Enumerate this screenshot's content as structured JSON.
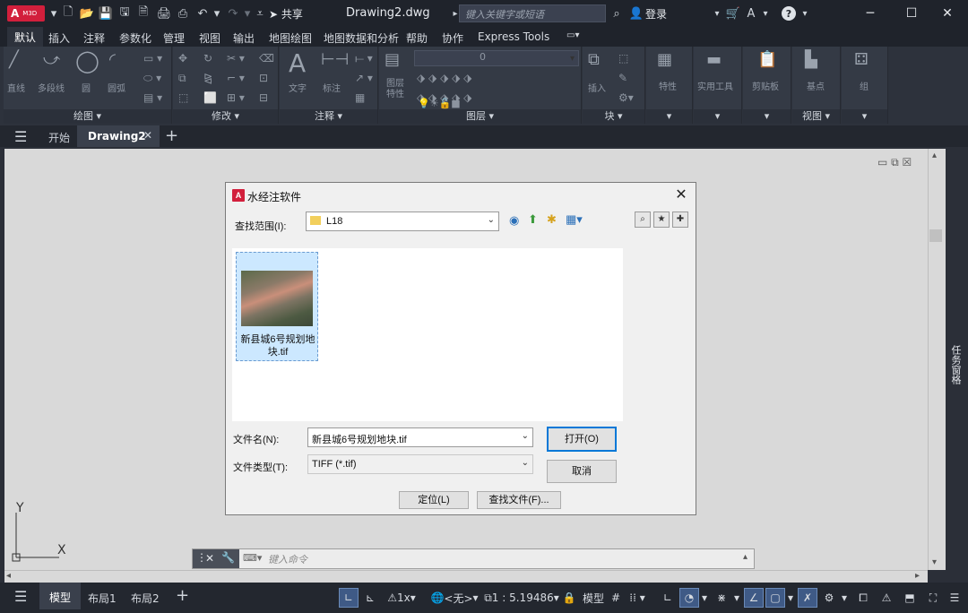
{
  "app": {
    "logo_text": "A",
    "logo_sub": "M3D",
    "doc_title": "Drawing2.dwg",
    "search_placeholder": "键入关键字或短语",
    "share_label": "共享",
    "login_label": "登录"
  },
  "ribbon_tabs": [
    "默认",
    "插入",
    "注释",
    "参数化",
    "管理",
    "视图",
    "输出",
    "地图绘图",
    "地图数据和分析",
    "帮助",
    "协作",
    "Express Tools"
  ],
  "ribbon": {
    "draw_tools": [
      "直线",
      "多段线",
      "圆",
      "圆弧"
    ],
    "draw_panel": "绘图",
    "modify_panel": "修改",
    "annot_tools": [
      "文字",
      "标注"
    ],
    "annot_panel": "注释",
    "layer_props_label": "图层\n特性",
    "layer_combo_value": "0",
    "layer_panel": "图层",
    "insert_label": "插入",
    "block_panel": "块",
    "props_label": "特性",
    "utils_label": "实用工具",
    "clipboard_label": "剪贴板",
    "base_label": "基点",
    "view_panel": "视图",
    "group_label": "组"
  },
  "file_tabs": {
    "start": "开始",
    "drawing": "Drawing2"
  },
  "dialog": {
    "title": "水经注软件",
    "lookin_label": "查找范围(I):",
    "lookin_value": "L18",
    "file": {
      "name": "新县城6号规划地块.tif"
    },
    "filename_label": "文件名(N):",
    "filename_value": "新县城6号规划地块.tif",
    "filetype_label": "文件类型(T):",
    "filetype_value": "TIFF (*.tif)",
    "open_button": "打开(O)",
    "cancel_button": "取消",
    "locate_button": "定位(L)",
    "find_button": "查找文件(F)..."
  },
  "canvas": {
    "ucs_x": "X",
    "ucs_y": "Y",
    "task_pane": "任务窗格"
  },
  "cmdline": {
    "placeholder": "键入命令"
  },
  "status": {
    "layout_tabs": [
      "模型",
      "布局1",
      "布局2"
    ],
    "scale_x": "1x",
    "ucs_none": "<无>",
    "scale": "1 : 5.19486",
    "model": "模型"
  }
}
